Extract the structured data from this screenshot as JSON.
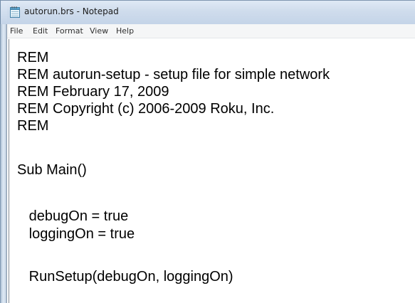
{
  "window": {
    "title": "autorun.brs - Notepad",
    "app_icon": "notepad-icon"
  },
  "menu": {
    "items": [
      "File",
      "Edit",
      "Format",
      "View",
      "Help"
    ]
  },
  "editor": {
    "lines": [
      "REM",
      "REM autorun-setup - setup file for simple network",
      "REM February 17, 2009",
      "REM Copyright (c) 2006-2009 Roku, Inc.",
      "REM",
      "",
      "Sub Main()",
      "",
      "   debugOn = true",
      "   loggingOn = true",
      "",
      "   RunSetup(debugOn, loggingOn)"
    ]
  }
}
